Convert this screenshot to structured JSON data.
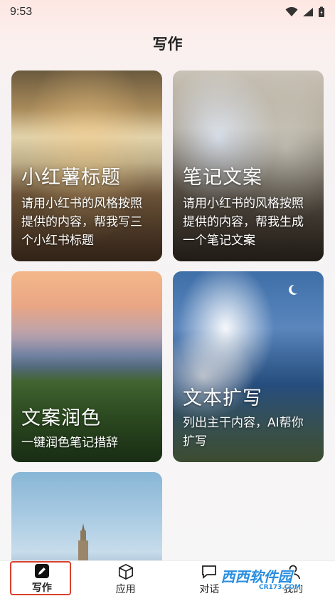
{
  "status_bar": {
    "time": "9:53"
  },
  "page": {
    "title": "写作"
  },
  "cards": [
    {
      "title": "小红薯标题",
      "desc": "请用小红书的风格按照提供的内容，帮我写三个小红书标题"
    },
    {
      "title": "笔记文案",
      "desc": "请用小红书的风格按照提供的内容，帮我生成一个笔记文案"
    },
    {
      "title": "文案润色",
      "desc": "一键润色笔记措辞"
    },
    {
      "title": "文本扩写",
      "desc": "列出主干内容，AI帮你扩写"
    },
    {
      "title": "",
      "desc": ""
    }
  ],
  "bottom_nav": {
    "items": [
      {
        "label": "写作",
        "icon": "pencil-icon"
      },
      {
        "label": "应用",
        "icon": "cube-icon"
      },
      {
        "label": "对话",
        "icon": "chat-icon"
      },
      {
        "label": "我的",
        "icon": "user-icon"
      }
    ]
  },
  "watermark": {
    "text": "西西软件园",
    "sub": "CR173.COM"
  },
  "colors": {
    "active_border": "#d9412c",
    "watermark": "#2a8ee0"
  }
}
